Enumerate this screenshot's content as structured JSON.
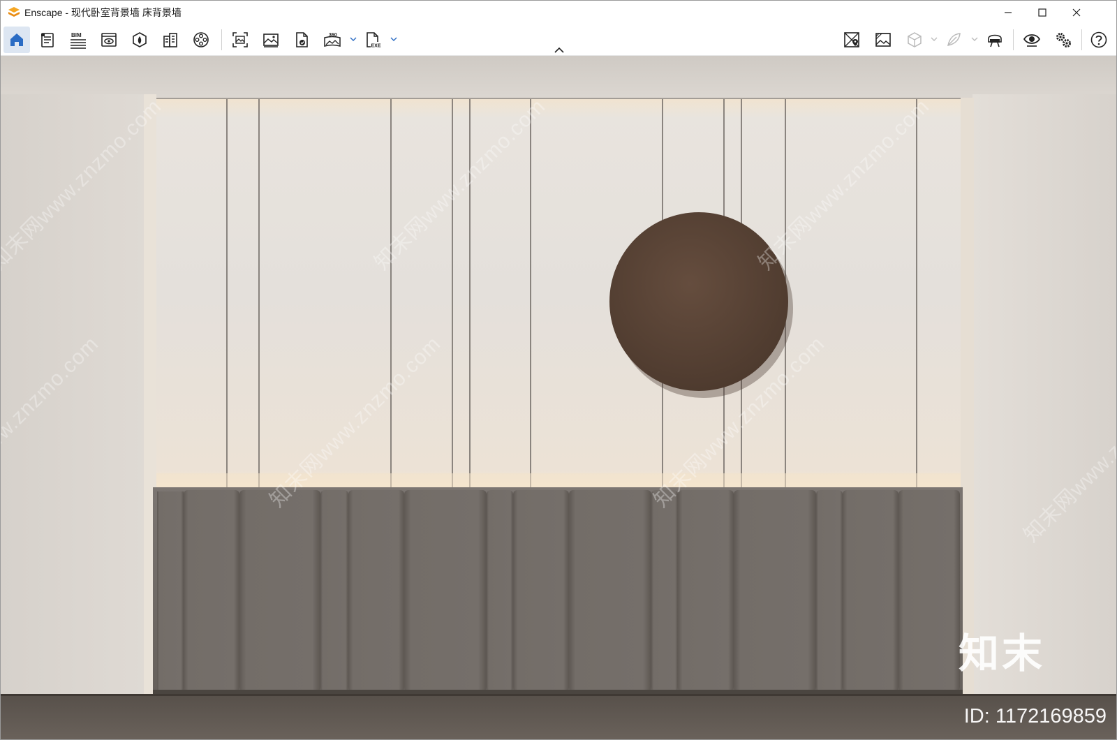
{
  "window": {
    "app_name": "Enscape",
    "title": "Enscape - 现代卧室背景墙 床背景墙",
    "controls": {
      "minimize": "minimize-icon",
      "maximize": "maximize-icon",
      "close": "close-icon"
    }
  },
  "toolbar": {
    "left_icons": [
      "home-icon",
      "document-list-icon",
      "bim-icon",
      "visual-settings-icon",
      "asset-library-icon",
      "building-icon",
      "video-reel-icon"
    ],
    "mid_icons": [
      "screenshot-icon",
      "image-icon",
      "file-export-icon",
      "panorama-360-icon",
      "exe-export-icon"
    ],
    "right_icons": [
      "map-pin-icon",
      "hatch-image-icon",
      "cube-view-icon",
      "feather-icon",
      "vr-headset-icon",
      "eye-icon",
      "settings-gears-icon",
      "help-icon"
    ],
    "labels": {
      "bim": "BIM",
      "pano": "360",
      "exe": "EXE"
    }
  },
  "viewport": {
    "watermark_text": "知末网www.znzmo.com",
    "brand_text": "知末",
    "id_text": "ID: 1172169859"
  },
  "colors": {
    "accent": "#2b6cc4",
    "wall": "#d8d3cd",
    "panel": "#ece8e3",
    "upholstery": "#6f6964",
    "disc": "#5a4537",
    "floor": "#5f5852"
  }
}
